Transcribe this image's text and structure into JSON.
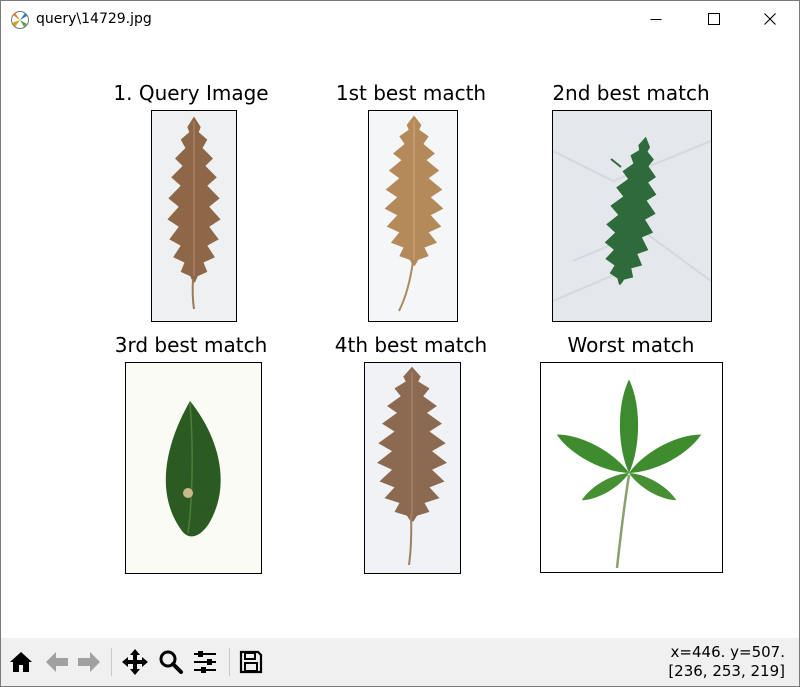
{
  "window": {
    "title": "query\\14729.jpg",
    "icons": {
      "app": "matplotlib-logo-icon",
      "minimize": "minimize-icon",
      "maximize": "maximize-icon",
      "close": "close-icon"
    }
  },
  "figure": {
    "subplots": [
      {
        "title": "1. Query Image",
        "image": "brown-oak-leaf"
      },
      {
        "title": "1st best macth",
        "image": "brown-oak-leaf"
      },
      {
        "title": "2nd best match",
        "image": "green-oak-leaf-on-paper"
      },
      {
        "title": "3rd best match",
        "image": "green-elliptic-leaf"
      },
      {
        "title": "4th best match",
        "image": "brown-oak-leaf"
      },
      {
        "title": "Worst match",
        "image": "chestnut-palmate-leaf"
      }
    ]
  },
  "toolbar": {
    "buttons": [
      {
        "name": "home-button",
        "icon": "home-icon"
      },
      {
        "name": "back-button",
        "icon": "back-arrow-icon"
      },
      {
        "name": "forward-button",
        "icon": "forward-arrow-icon"
      },
      {
        "name": "pan-button",
        "icon": "move-icon"
      },
      {
        "name": "zoom-button",
        "icon": "magnifier-icon"
      },
      {
        "name": "configure-subplots-button",
        "icon": "sliders-icon"
      },
      {
        "name": "save-button",
        "icon": "floppy-disk-icon"
      }
    ],
    "coords_line1": "x=446. y=507.",
    "coords_line2": "[236, 253, 219]"
  }
}
